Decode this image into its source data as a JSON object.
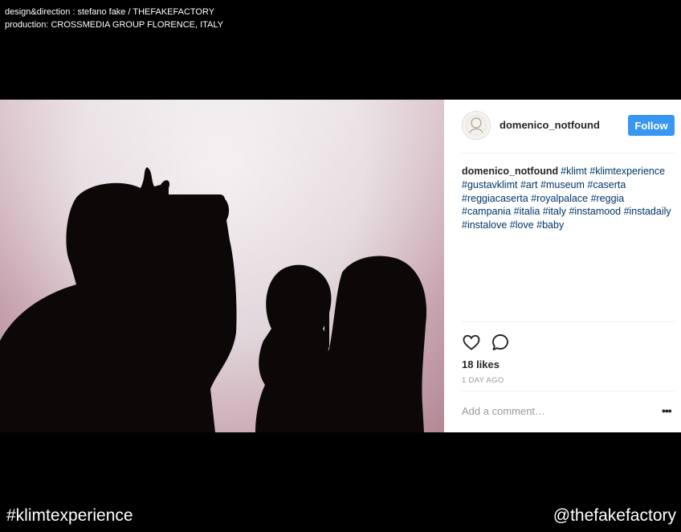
{
  "credits": {
    "line1": "design&direction : stefano fake / THEFAKEFACTORY",
    "line2": "production: CROSSMEDIA GROUP FLORENCE, ITALY"
  },
  "post": {
    "username": "domenico_notfound",
    "follow_label": "Follow",
    "caption_user": "domenico_notfound",
    "hashtags": [
      "#klimt",
      "#klimtexperience",
      "#gustavklimt",
      "#art",
      "#museum",
      "#caserta",
      "#reggiacaserta",
      "#royalpalace",
      "#reggia",
      "#campania",
      "#italia",
      "#italy",
      "#instamood",
      "#instadaily",
      "#instalove",
      "#love",
      "#baby"
    ],
    "likes": "18 likes",
    "time": "1 DAY AGO",
    "comment_placeholder": "Add a comment…",
    "more_label": "•••"
  },
  "footer": {
    "hashtag": "#klimtexperience",
    "handle": "@thefakefactory"
  },
  "icons": [
    "heart-icon",
    "comment-icon",
    "more-options-icon"
  ],
  "colors": {
    "background": "#000000",
    "follow_button": "#3897f0",
    "hashtag": "#003569",
    "text_dark": "#262626",
    "text_muted": "#999999"
  }
}
